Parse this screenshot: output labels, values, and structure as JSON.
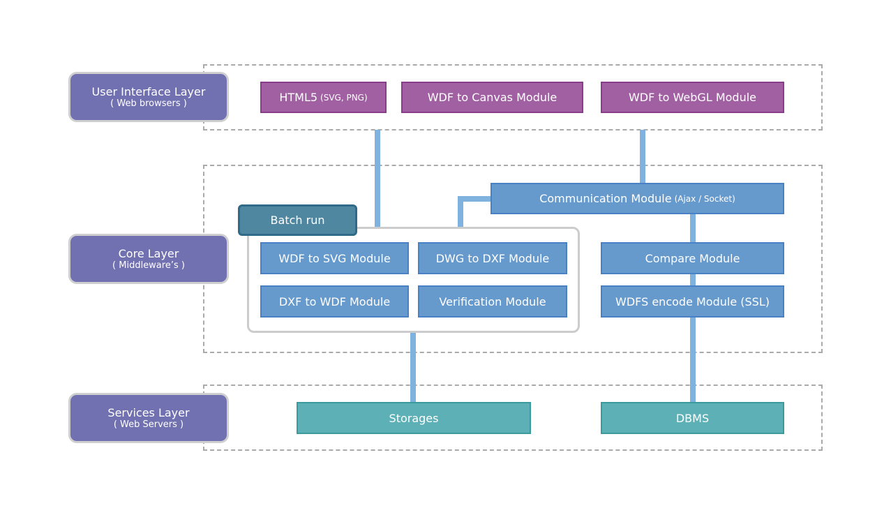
{
  "layers": [
    {
      "title": "User Interface Layer",
      "subtitle": "( Web browsers )"
    },
    {
      "title": "Core Layer",
      "subtitle": "( Middleware’s )"
    },
    {
      "title": "Services Layer",
      "subtitle": "( Web Servers )"
    }
  ],
  "ui_modules": {
    "html5": {
      "label": "HTML5",
      "note": "(SVG, PNG)"
    },
    "canvas": "WDF to Canvas Module",
    "webgl": "WDF to WebGL Module"
  },
  "core": {
    "communication": {
      "label": "Communication Module",
      "note": "(Ajax / Socket)"
    },
    "batch_run": "Batch run",
    "batch_modules": [
      "WDF to SVG Module",
      "DWG to DXF Module",
      "DXF to WDF Module",
      "Verification Module"
    ],
    "compare": "Compare Module",
    "wdfs": "WDFS encode Module (SSL)"
  },
  "services": {
    "storages": "Storages",
    "dbms": "DBMS"
  },
  "colors": {
    "layer": "#7170b0",
    "ui_module": "#a060a2",
    "core_module": "#6699cc",
    "batch_header": "#4f86a0",
    "service": "#5db0b5",
    "connector": "#80b2e0"
  }
}
